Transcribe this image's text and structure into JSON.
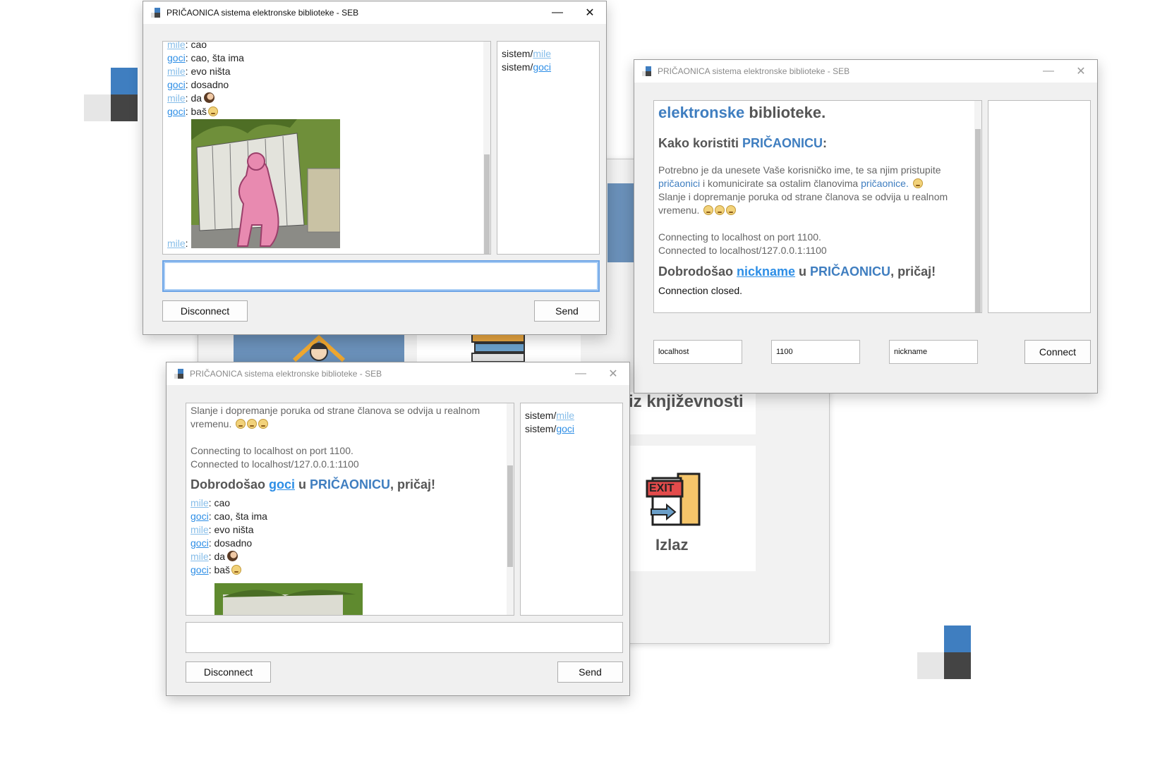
{
  "window_title": "PRIČAONICA sistema elektronske biblioteke - SEB",
  "window_controls": {
    "minimize": "—",
    "close": "✕"
  },
  "menu": {
    "tile_label_knjizevnost": "iz književnosti",
    "tile_label_izlaz": "Izlaz",
    "exit_sign": "EXIT"
  },
  "chat1": {
    "lines": [
      {
        "nick": "mile",
        "text": ": cao"
      },
      {
        "nick": "goci",
        "text": ": cao, šta ima"
      },
      {
        "nick": "mile",
        "text": ": evo ništa"
      },
      {
        "nick": "goci",
        "text": ": dosadno"
      },
      {
        "nick": "mile",
        "text": ": da"
      },
      {
        "nick": "goci",
        "text": ": baš"
      },
      {
        "nick": "mile",
        "text": ":"
      }
    ],
    "users": [
      {
        "prefix": "sistem/",
        "nick": "mile"
      },
      {
        "prefix": "sistem/",
        "nick": "goci"
      }
    ],
    "input_value": "",
    "disconnect_label": "Disconnect",
    "send_label": "Send"
  },
  "chat2": {
    "info_lines": [
      "Slanje i dopremanje poruka od strane članova se odvija u realnom",
      "vremenu.",
      "Connecting to localhost on port 1100.",
      "Connected to localhost/127.0.0.1:1100"
    ],
    "welcome": {
      "pre": "Dobrodošao ",
      "nick": "goci",
      "mid": " u ",
      "room": "PRIČAONICU",
      "post": ", pričaj!"
    },
    "lines": [
      {
        "nick": "mile",
        "text": ": cao"
      },
      {
        "nick": "goci",
        "text": ": cao, šta ima"
      },
      {
        "nick": "mile",
        "text": ": evo ništa"
      },
      {
        "nick": "goci",
        "text": ": dosadno"
      },
      {
        "nick": "mile",
        "text": ": da"
      },
      {
        "nick": "goci",
        "text": ": baš"
      }
    ],
    "users": [
      {
        "prefix": "sistem/",
        "nick": "mile"
      },
      {
        "prefix": "sistem/",
        "nick": "goci"
      }
    ],
    "input_value": "",
    "disconnect_label": "Disconnect",
    "send_label": "Send"
  },
  "connect_window": {
    "heading": {
      "blue": "elektronske",
      "rest": " biblioteke."
    },
    "howto": {
      "pre": "Kako koristiti ",
      "room": "PRIČAONICU",
      "post": ":"
    },
    "para1_a": "Potrebno je da unesete Vaše korisničko ime, te sa njim pristupite",
    "para1_b_link": "pričaonici",
    "para1_b_mid": " i komunicirate sa ostalim članovima ",
    "para1_b_link2": "pričaonice.",
    "para2_a": "Slanje i dopremanje poruka od strane članova se odvija u realnom",
    "para2_b": "vremenu.",
    "status1": "Connecting to localhost on port 1100.",
    "status2": "Connected to localhost/127.0.0.1:1100",
    "welcome": {
      "pre": "Dobrodošao ",
      "nick": "nickname",
      "mid": " u ",
      "room": "PRIČAONICU",
      "post": ", pričaj!"
    },
    "closed": "Connection closed.",
    "host_value": "localhost",
    "port_value": "1100",
    "nick_value": "nickname",
    "connect_label": "Connect"
  },
  "colors": {
    "accent": "#3f7ec0",
    "link": "#2d8ee6",
    "dark_square": "#444444",
    "light_square": "#e6e6e6"
  }
}
